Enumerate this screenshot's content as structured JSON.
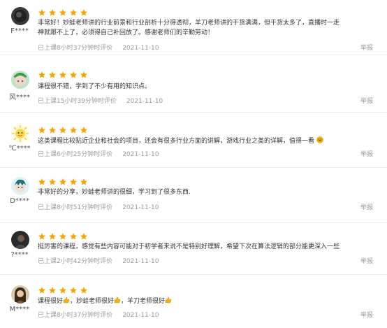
{
  "reviews": [
    {
      "username": "F****",
      "rating": 5,
      "content": "非常好！妙蛙老师讲的行业前景和行业剖析十分得透彻，羊刀老师讲的干货满满，但干货太多了，直播时一走神就跟不上了，必须得自己补回放了。感谢老师们的辛勤劳动！",
      "meta": "已上课8小时37分钟时评价",
      "date": "2021-11-10",
      "report": "举报",
      "avatar": "dark-circle"
    },
    {
      "username": "风****",
      "rating": 5,
      "content": "课程很不错，学到了不少有用的知识点。",
      "meta": "已上课15小时39分钟时评价",
      "date": "2021-11-10",
      "report": "举报",
      "avatar": "anime-boy-green"
    },
    {
      "username": "℃****",
      "rating": 5,
      "content": "这类课程比较贴近企业和社会的项目，还会有很多行业方面的讲解，游戏行业之类的详解，值得一看",
      "meta": "已上课6小时25分钟时评价",
      "date": "2021-11-10",
      "report": "举报",
      "avatar": "sun-face",
      "emoji": "grin-emoji"
    },
    {
      "username": "D****",
      "rating": 5,
      "content": "非常好的分享，妙蛙老师讲的很细，学习到了很多东西.",
      "meta": "已上课8小时51分钟时评价",
      "date": "2021-11-10",
      "report": "举报",
      "avatar": "anime-character-teal"
    },
    {
      "username": "?****",
      "rating": 5,
      "content": "挺厉害的课程，感觉有些内容可能对于初学者来说不是特别好理解，希望下次在算法逻辑的部分能更深入一些",
      "meta": "已上课2小时42分钟时评价",
      "date": "2021-11-10",
      "report": "举报",
      "avatar": "dark-portrait"
    },
    {
      "username": "M****",
      "rating": 5,
      "content_parts": [
        "课程很好",
        "，妙蛙老师很好",
        "，羊刀老师很好"
      ],
      "meta": "已上课8小时37分钟时评价",
      "date": "2021-11-10",
      "report": "举报",
      "avatar": "woman-portrait",
      "emoji": "thumbs-up-emoji"
    }
  ],
  "colors": {
    "star": "#f5a300",
    "meta": "#9a9a9a",
    "text": "#333333",
    "divider": "#ececec"
  }
}
